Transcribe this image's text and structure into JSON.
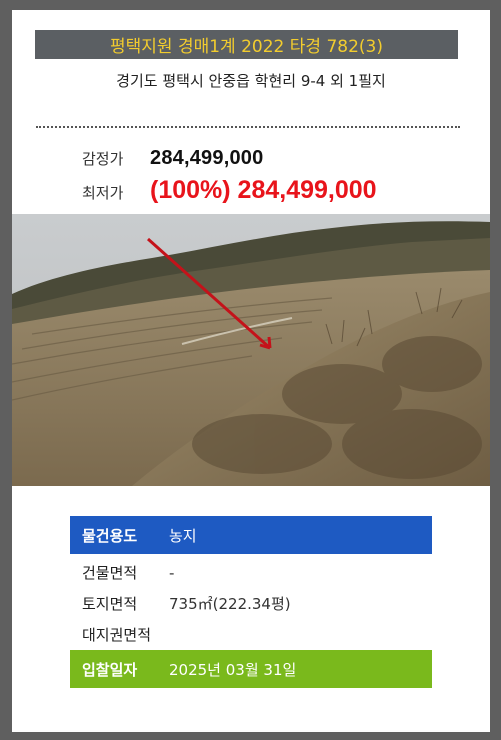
{
  "header": {
    "title": "평택지원 경매1계 2022 타경 782(3)",
    "address": "경기도 평택시 안중읍 학현리 9-4 외 1필지"
  },
  "prices": {
    "appraisal_label": "감정가",
    "appraisal_value": "284,499,000",
    "minimum_label": "최저가",
    "minimum_value": "(100%) 284,499,000"
  },
  "photo": {
    "subject": "farmland-photo",
    "arrow_color": "#c4121a"
  },
  "details": {
    "rows": [
      {
        "label": "물건용도",
        "value": "농지"
      },
      {
        "label": "건물면적",
        "value": "-"
      },
      {
        "label": "토지면적",
        "value": "735㎡(222.34평)"
      },
      {
        "label": "대지권면적",
        "value": ""
      },
      {
        "label": "입찰일자",
        "value": "2025년 03월 31일"
      }
    ]
  },
  "colors": {
    "title_bg": "#5b5f63",
    "title_text": "#f2cc2e",
    "minimum_price": "#e8141b",
    "usage_row": "#1e5ac2",
    "bid_date_row": "#7ab91c"
  }
}
